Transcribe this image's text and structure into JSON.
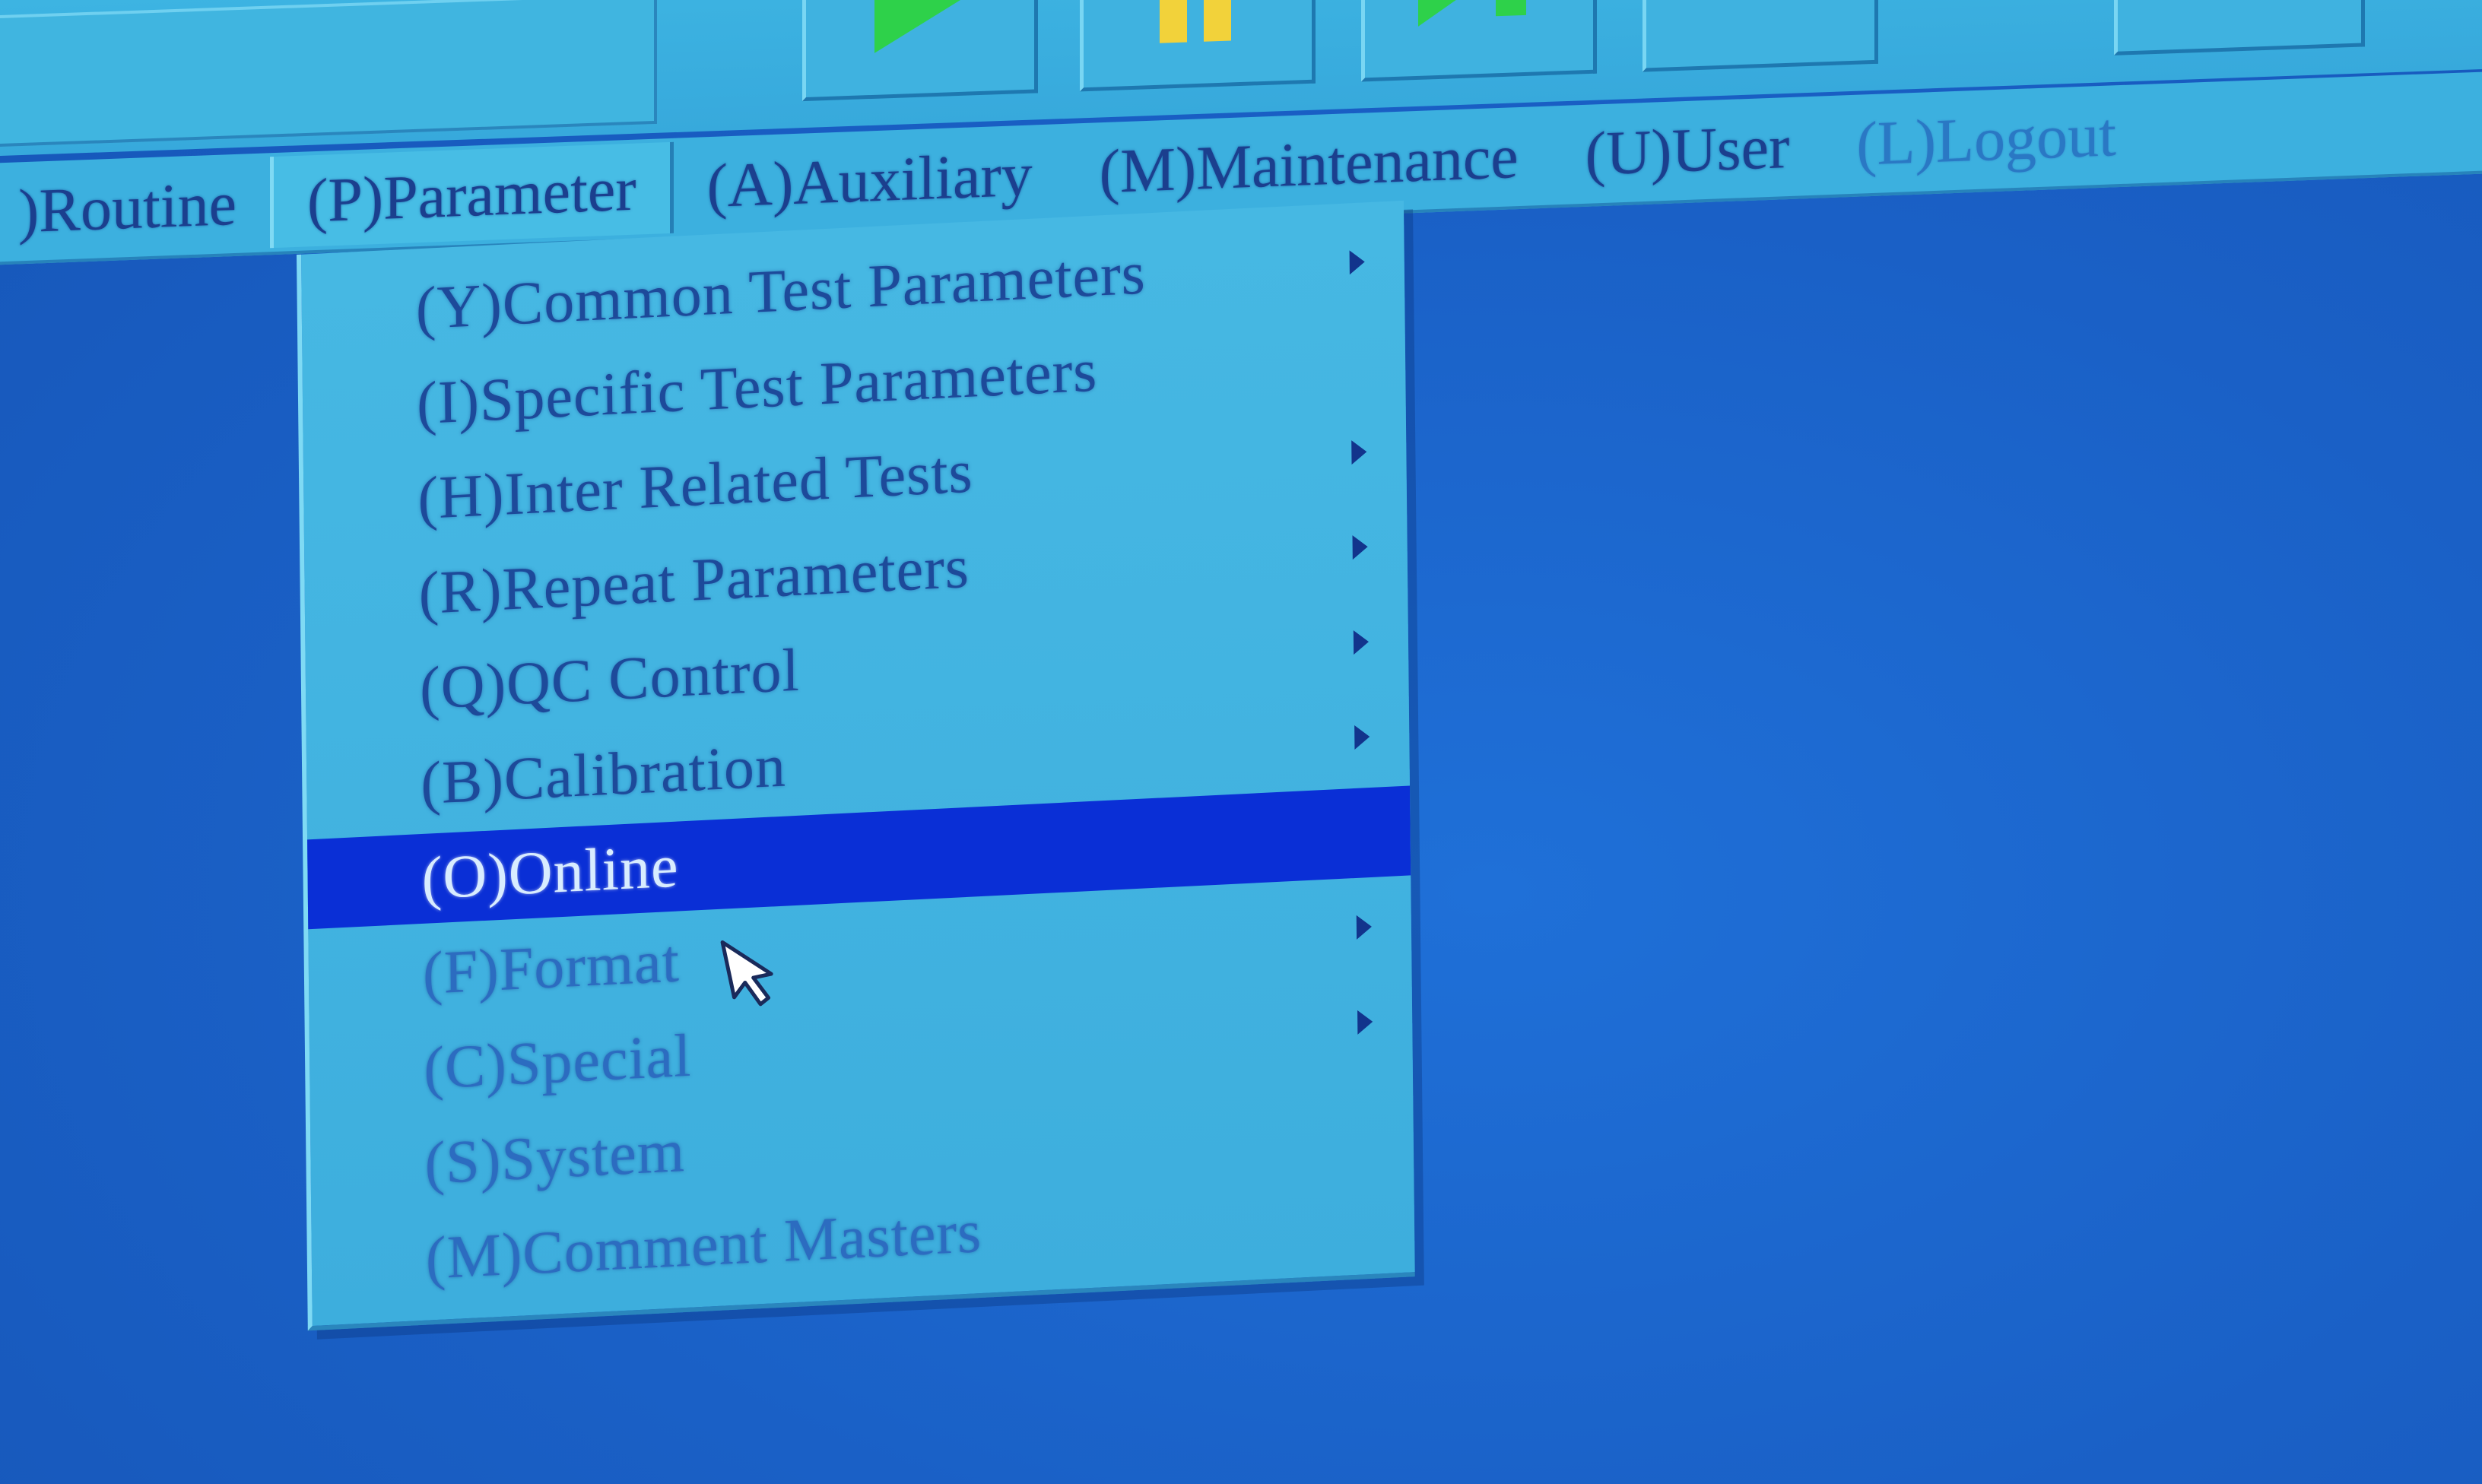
{
  "menubar": {
    "items": [
      {
        "label": ")Routine"
      },
      {
        "label": "(P)Parameter"
      },
      {
        "label": "(A)Auxiliary"
      },
      {
        "label": "(M)Maintenance"
      },
      {
        "label": "(U)User"
      },
      {
        "label": "(L)Logout"
      }
    ]
  },
  "dropdown": {
    "items": [
      {
        "label": "(Y)Common Test Parameters",
        "has_submenu": true
      },
      {
        "label": "(I)Specific Test Parameters",
        "has_submenu": false
      },
      {
        "label": "(H)Inter Related Tests",
        "has_submenu": true
      },
      {
        "label": "(R)Repeat Parameters",
        "has_submenu": true
      },
      {
        "label": "(Q)QC Control",
        "has_submenu": true
      },
      {
        "label": "(B)Calibration",
        "has_submenu": true
      },
      {
        "label": "(O)Online",
        "has_submenu": false,
        "selected": true
      },
      {
        "label": "(F)Format",
        "has_submenu": true
      },
      {
        "label": "(C)Special",
        "has_submenu": true
      },
      {
        "label": "(S)System",
        "has_submenu": true
      },
      {
        "label": "(M)Comment Masters",
        "has_submenu": false
      }
    ]
  },
  "toolbar": {
    "buttons": [
      {
        "icon": "play-icon",
        "color": "#2ed14a"
      },
      {
        "icon": "pause-icon",
        "color": "#f2d23a"
      },
      {
        "icon": "step-play-icon",
        "color": "#2ed14a"
      },
      {
        "icon": "stop-icon",
        "color": "#f4f4f4"
      },
      {
        "icon": "window-icon",
        "color": "#b9c6f0"
      }
    ]
  },
  "colors": {
    "background": "#1b63c9",
    "menu": "#3cb0df",
    "selection": "#0a2fd6",
    "menu_text": "#1b3f8e"
  }
}
